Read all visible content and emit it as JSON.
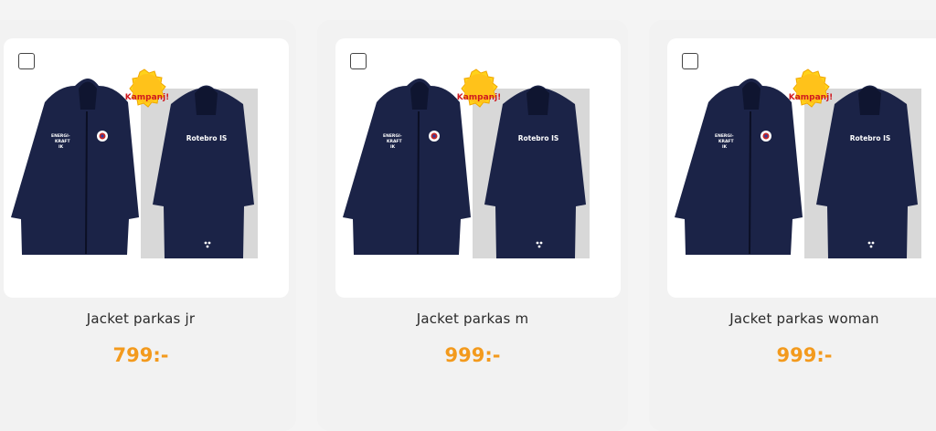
{
  "products": [
    {
      "title": "Jacket parkas jr",
      "price": "799:-",
      "badge": "Kampanj!",
      "back_text": "Rotebro IS",
      "front_text_1": "ENERGI-",
      "front_text_2": "KRAFT",
      "front_text_3": "IK"
    },
    {
      "title": "Jacket parkas m",
      "price": "999:-",
      "badge": "Kampanj!",
      "back_text": "Rotebro IS",
      "front_text_1": "ENERGI-",
      "front_text_2": "KRAFT",
      "front_text_3": "IK"
    },
    {
      "title": "Jacket parkas woman",
      "price": "999:-",
      "badge": "Kampanj!",
      "back_text": "Rotebro IS",
      "front_text_1": "ENERGI-",
      "front_text_2": "KRAFT",
      "front_text_3": "IK"
    }
  ],
  "colors": {
    "price": "#f39a1d",
    "navy": "#1b2347",
    "badge_yellow": "#ffd21a",
    "badge_text": "#d0191f"
  },
  "icons": {
    "checkbox": "checkbox-empty-icon",
    "badge": "sunburst-badge-icon"
  }
}
